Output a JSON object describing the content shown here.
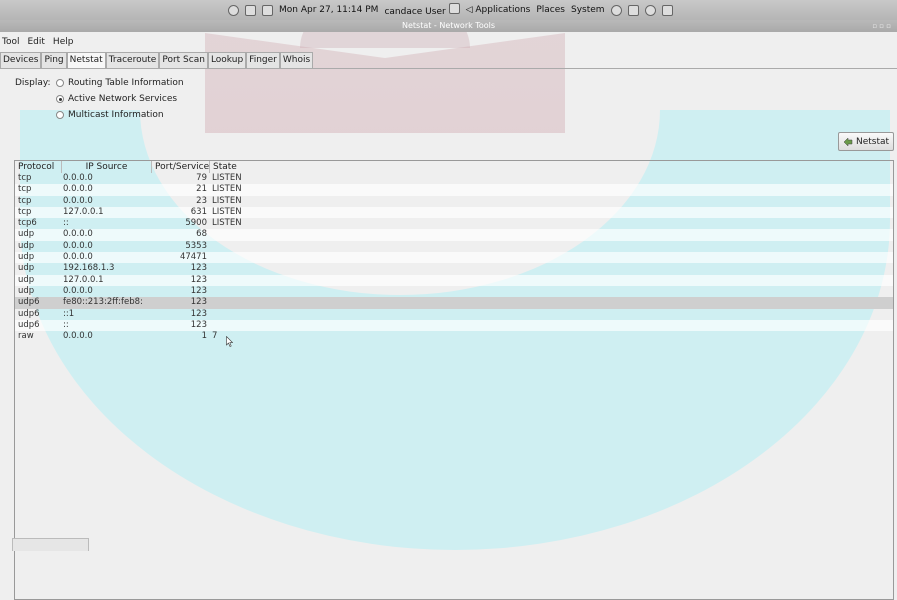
{
  "topbar": {
    "clock": "Mon Apr 27, 11:14 PM",
    "user": "candace User",
    "applications": "Applications",
    "places": "Places",
    "system": "System"
  },
  "window": {
    "title": "Netstat - Network Tools"
  },
  "menu": {
    "tool": "Tool",
    "edit": "Edit",
    "help": "Help"
  },
  "tabs": [
    "Devices",
    "Ping",
    "Netstat",
    "Traceroute",
    "Port Scan",
    "Lookup",
    "Finger",
    "Whois"
  ],
  "display": {
    "label": "Display:",
    "options": [
      "Routing Table Information",
      "Active Network Services",
      "Multicast Information"
    ],
    "selected": "Active Network Services"
  },
  "netstat_button": "Netstat",
  "table": {
    "headers": [
      "Protocol",
      "IP Source",
      "Port/Service",
      "State"
    ],
    "rows": [
      [
        "tcp",
        "0.0.0.0",
        "79",
        "LISTEN"
      ],
      [
        "tcp",
        "0.0.0.0",
        "21",
        "LISTEN"
      ],
      [
        "tcp",
        "0.0.0.0",
        "23",
        "LISTEN"
      ],
      [
        "tcp",
        "127.0.0.1",
        "631",
        "LISTEN"
      ],
      [
        "tcp6",
        "::",
        "5900",
        "LISTEN"
      ],
      [
        "udp",
        "0.0.0.0",
        "68",
        ""
      ],
      [
        "udp",
        "0.0.0.0",
        "5353",
        ""
      ],
      [
        "udp",
        "0.0.0.0",
        "47471",
        ""
      ],
      [
        "udp",
        "192.168.1.3",
        "123",
        ""
      ],
      [
        "udp",
        "127.0.0.1",
        "123",
        ""
      ],
      [
        "udp",
        "0.0.0.0",
        "123",
        ""
      ],
      [
        "udp6",
        "fe80::213:2ff:feb8:",
        "123",
        ""
      ],
      [
        "udp6",
        "::1",
        "123",
        ""
      ],
      [
        "udp6",
        "::",
        "123",
        ""
      ],
      [
        "raw",
        "0.0.0.0",
        "1",
        "7"
      ]
    ],
    "highlighted_row": 11
  }
}
